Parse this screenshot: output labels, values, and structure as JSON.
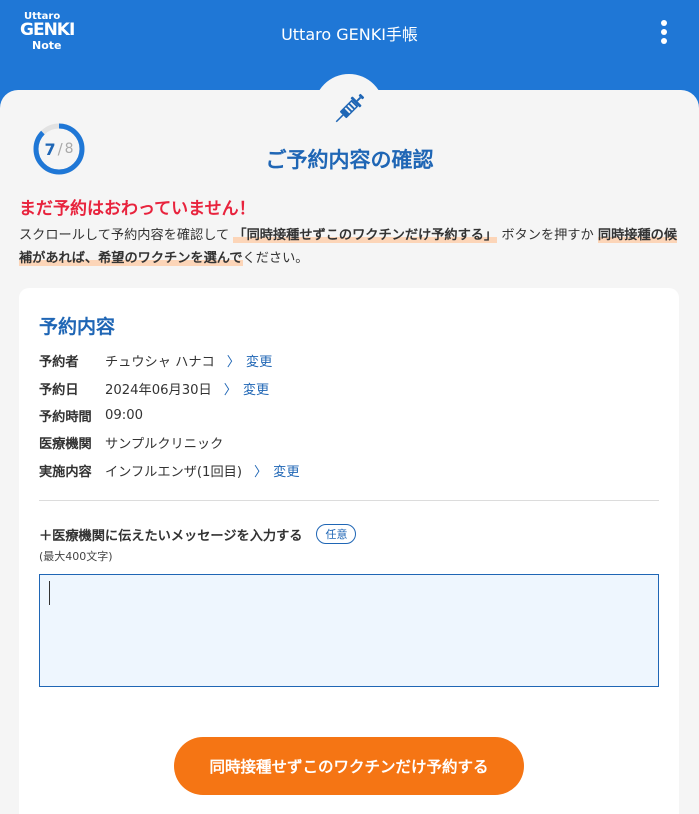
{
  "header": {
    "logo_line1": "Uttaro",
    "logo_line2": "GENKI",
    "logo_line3": "Note",
    "title": "Uttaro GENKI手帳",
    "menu_icon": "more-vertical-icon"
  },
  "progress": {
    "current": "7",
    "separator": "/",
    "total": "8",
    "fraction": 0.875
  },
  "page_title": "ご予約内容の確認",
  "warning": "まだ予約はおわっていません！",
  "instructions": {
    "part1": "スクロールして予約内容を確認して",
    "highlight1": "「同時接種せずこのワクチンだけ予約する」",
    "part2": "ボタンを押すか",
    "highlight2": "同時接種の候補があれば、希望のワクチンを選んで",
    "part3": "ください。"
  },
  "card": {
    "title": "予約内容",
    "rows": [
      {
        "label": "予約者",
        "value": "チュウシャ ハナコ",
        "change": "変更"
      },
      {
        "label": "予約日",
        "value": "2024年06月30日",
        "change": "変更"
      },
      {
        "label": "予約時間",
        "value": "09:00",
        "change": ""
      },
      {
        "label": "医療機関",
        "value": "サンプルクリニック",
        "change": ""
      },
      {
        "label": "実施内容",
        "value": "インフルエンザ(1回目)",
        "change": "変更"
      }
    ],
    "chevron": "〉",
    "message_label": "＋医療機関に伝えたいメッセージを入力する",
    "optional_badge": "任意",
    "message_note": "(最大400文字)",
    "message_value": "",
    "submit_label": "同時接種せずこのワクチンだけ予約する"
  },
  "colors": {
    "brand_blue": "#1f77d6",
    "title_blue": "#1f66b5",
    "warning_red": "#e8233d",
    "accent_orange": "#f57514",
    "highlight": "#fcd5b8"
  }
}
